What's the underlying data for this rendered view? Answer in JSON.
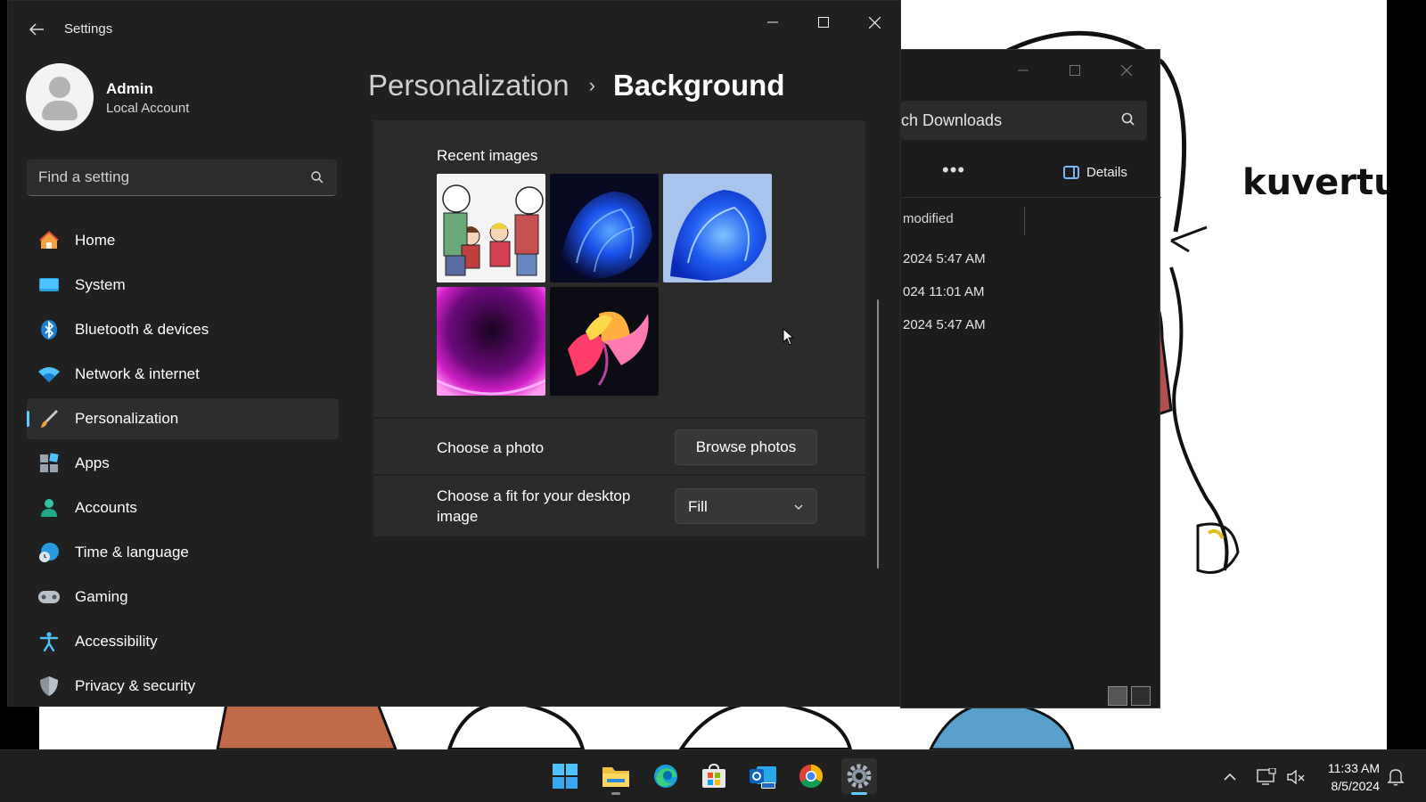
{
  "settings": {
    "window_title": "Settings",
    "profile": {
      "name": "Admin",
      "account_type": "Local Account"
    },
    "search": {
      "placeholder": "Find a setting"
    },
    "nav": [
      {
        "label": "Home",
        "icon": "home-icon"
      },
      {
        "label": "System",
        "icon": "system-icon"
      },
      {
        "label": "Bluetooth & devices",
        "icon": "bluetooth-icon"
      },
      {
        "label": "Network & internet",
        "icon": "wifi-icon"
      },
      {
        "label": "Personalization",
        "icon": "paintbrush-icon",
        "selected": true
      },
      {
        "label": "Apps",
        "icon": "apps-icon"
      },
      {
        "label": "Accounts",
        "icon": "accounts-icon"
      },
      {
        "label": "Time & language",
        "icon": "globe-clock-icon"
      },
      {
        "label": "Gaming",
        "icon": "gamepad-icon"
      },
      {
        "label": "Accessibility",
        "icon": "accessibility-icon"
      },
      {
        "label": "Privacy & security",
        "icon": "shield-icon"
      }
    ],
    "breadcrumb": {
      "parent": "Personalization",
      "separator": "›",
      "current": "Background"
    },
    "recent_images": {
      "title": "Recent images",
      "items": [
        "cartoon-characters-wallpaper",
        "blue-bloom-dark-wallpaper",
        "blue-bloom-light-wallpaper",
        "purple-glow-wallpaper",
        "colorful-flower-wallpaper"
      ]
    },
    "choose_photo": {
      "label": "Choose a photo",
      "button": "Browse photos"
    },
    "choose_fit": {
      "label": "Choose a fit for your desktop image",
      "value": "Fill"
    },
    "accent_color": "#60cdff"
  },
  "explorer": {
    "search_text": "ch Downloads",
    "details_label": "Details",
    "more_label": "•••",
    "column_header": "modified",
    "rows": [
      "2024 5:47 AM",
      "024 11:01 AM",
      "2024 5:47 AM"
    ]
  },
  "wallpaper": {
    "text": "kuvertu"
  },
  "taskbar": {
    "apps": [
      "start-icon",
      "file-explorer-icon",
      "edge-icon",
      "store-icon",
      "outlook-icon",
      "chrome-icon",
      "settings-icon"
    ],
    "time": "11:33 AM",
    "date": "8/5/2024"
  }
}
